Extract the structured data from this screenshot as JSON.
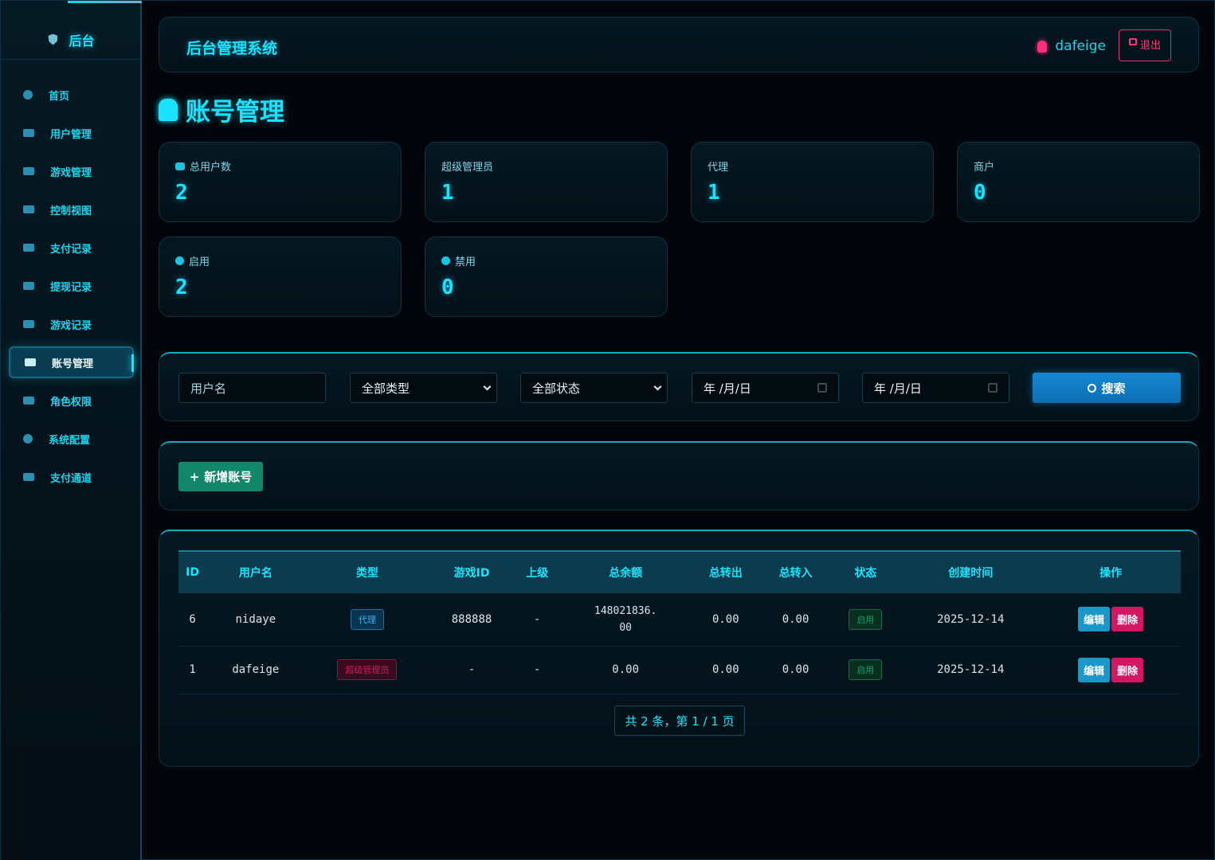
{
  "sidebar": {
    "brand": "后台",
    "items": [
      {
        "label": "首页",
        "icon": "dashboard-icon"
      },
      {
        "label": "用户管理",
        "icon": "users-icon"
      },
      {
        "label": "游戏管理",
        "icon": "gamepad-icon"
      },
      {
        "label": "控制视图",
        "icon": "sliders-icon"
      },
      {
        "label": "支付记录",
        "icon": "money-icon"
      },
      {
        "label": "提现记录",
        "icon": "money-icon"
      },
      {
        "label": "游戏记录",
        "icon": "list-icon"
      },
      {
        "label": "账号管理",
        "icon": "id-card-icon",
        "active": true
      },
      {
        "label": "角色权限",
        "icon": "shield-icon"
      },
      {
        "label": "系统配置",
        "icon": "gear-icon"
      },
      {
        "label": "支付通道",
        "icon": "qrcode-icon"
      }
    ]
  },
  "header": {
    "title": "后台管理系统",
    "username": "dafeige",
    "logout_label": "退出"
  },
  "page": {
    "title": "账号管理"
  },
  "stats": [
    {
      "label": "总用户数",
      "value": "2",
      "icon": "users-icon"
    },
    {
      "label": "超级管理员",
      "value": "1"
    },
    {
      "label": "代理",
      "value": "1"
    },
    {
      "label": "商户",
      "value": "0"
    },
    {
      "label": "启用",
      "value": "2",
      "icon": "check-circle-icon"
    },
    {
      "label": "禁用",
      "value": "0",
      "icon": "x-circle-icon"
    }
  ],
  "filters": {
    "username_placeholder": "用户名",
    "type_selected": "全部类型",
    "status_selected": "全部状态",
    "date_from": "年 /月/日",
    "date_to": "年 /月/日",
    "search_label": "搜索"
  },
  "actions": {
    "add_label": "新增账号"
  },
  "table": {
    "columns": [
      "ID",
      "用户名",
      "类型",
      "游戏ID",
      "上级",
      "总余额",
      "总转出",
      "总转入",
      "状态",
      "创建时间",
      "操作"
    ],
    "rows": [
      {
        "id": "6",
        "username": "nidaye",
        "type": "代理",
        "game_id": "888888",
        "parent": "-",
        "balance_line1": "148021836.",
        "balance_line2": "00",
        "out": "0.00",
        "in": "0.00",
        "status": "启用",
        "created": "2025-12-14",
        "edit": "编辑",
        "del": "删除"
      },
      {
        "id": "1",
        "username": "dafeige",
        "type": "超级管理员",
        "game_id": "-",
        "parent": "-",
        "balance_line1": "0.00",
        "balance_line2": "",
        "out": "0.00",
        "in": "0.00",
        "status": "启用",
        "created": "2025-12-14",
        "edit": "编辑",
        "del": "删除"
      }
    ]
  },
  "pager": {
    "text": "共 2 条，第 1 / 1 页"
  },
  "colors": {
    "accent": "#19e3ff",
    "danger": "#d41762",
    "success": "#13876a",
    "primary": "#1587cf"
  }
}
